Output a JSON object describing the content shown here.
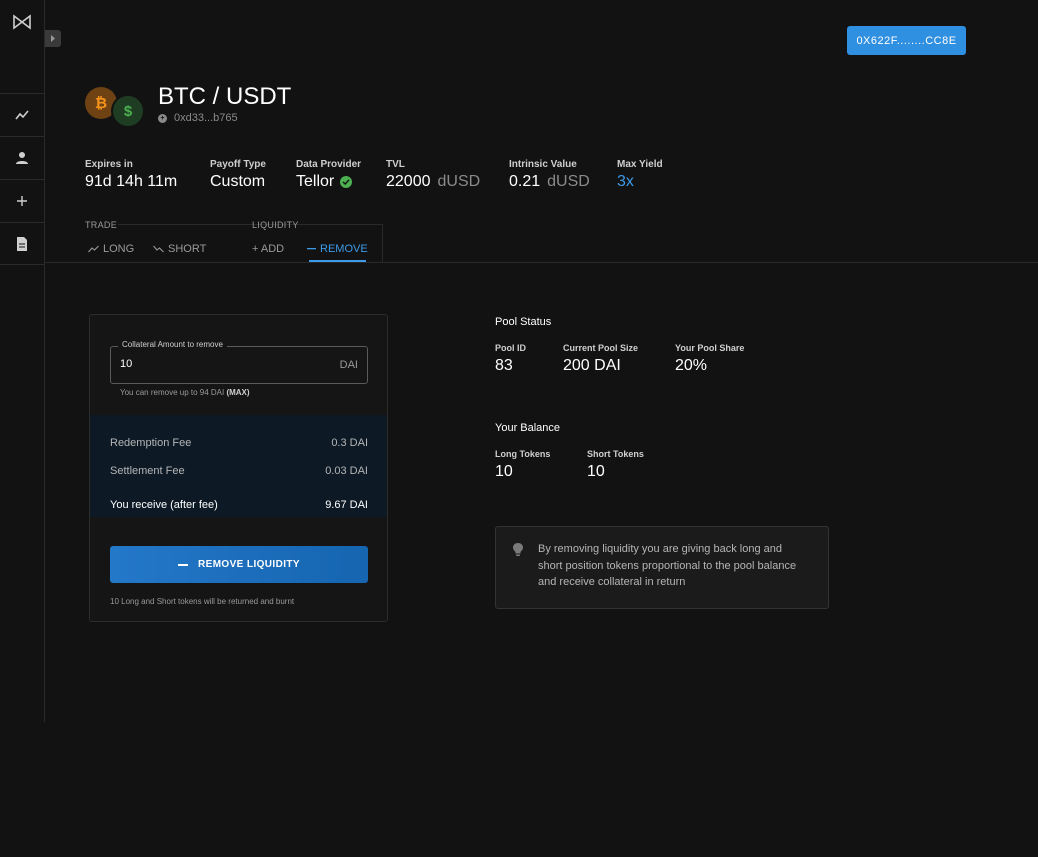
{
  "wallet": {
    "address": "0X622F........CC8E"
  },
  "pool": {
    "title": "BTC / USDT",
    "address": "0xd33...b765"
  },
  "stats": {
    "expires": {
      "label": "Expires in",
      "value": "91d 14h 11m"
    },
    "payoff": {
      "label": "Payoff Type",
      "value": "Custom"
    },
    "provider": {
      "label": "Data Provider",
      "value": "Tellor"
    },
    "tvl": {
      "label": "TVL",
      "value": "22000",
      "unit": "dUSD"
    },
    "intrinsic": {
      "label": "Intrinsic Value",
      "value": "0.21",
      "unit": "dUSD"
    },
    "yield": {
      "label": "Max Yield",
      "value": "3x"
    }
  },
  "tabs": {
    "trade_label": "TRADE",
    "long": "LONG",
    "short": "SHORT",
    "liquidity_label": "LIQUIDITY",
    "add": "+ ADD",
    "remove": "REMOVE"
  },
  "remove_form": {
    "field_label": "Collateral Amount to remove",
    "value": "10",
    "unit": "DAI",
    "helper": "You can remove up to 94 DAI",
    "max": "(MAX)",
    "redemption_fee": {
      "label": "Redemption Fee",
      "value": "0.3 DAI"
    },
    "settlement_fee": {
      "label": "Settlement Fee",
      "value": "0.03 DAI"
    },
    "receive": {
      "label": "You receive (after fee)",
      "value": "9.67 DAI"
    },
    "button": "REMOVE LIQUIDITY",
    "note": "10 Long and Short tokens will be returned and burnt"
  },
  "pool_status": {
    "title": "Pool Status",
    "pool_id": {
      "label": "Pool ID",
      "value": "83"
    },
    "pool_size": {
      "label": "Current Pool Size",
      "value": "200 DAI"
    },
    "share": {
      "label": "Your Pool Share",
      "value": "20%"
    }
  },
  "balance": {
    "title": "Your Balance",
    "long": {
      "label": "Long Tokens",
      "value": "10"
    },
    "short": {
      "label": "Short Tokens",
      "value": "10"
    }
  },
  "info": {
    "text": "By removing liquidity you are giving back long and short position tokens proportional to the pool balance and receive collateral in return"
  },
  "colors": {
    "accent": "#3d9ae8",
    "button": "#2f8fe0",
    "success": "#4caf50"
  }
}
